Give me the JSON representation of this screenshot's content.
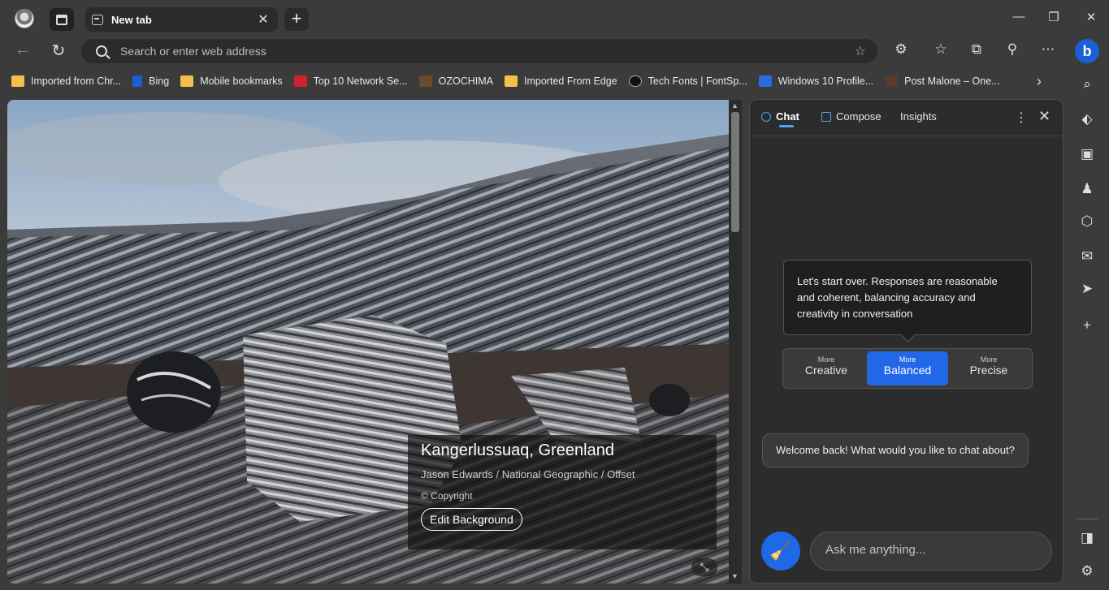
{
  "tab": {
    "title": "New tab"
  },
  "omnibox": {
    "placeholder": "Search or enter web address"
  },
  "bookmarks": [
    {
      "label": "Imported from Chr...",
      "icon": "folder-icon"
    },
    {
      "label": "Bing",
      "icon": "bing-icon"
    },
    {
      "label": "Mobile bookmarks",
      "icon": "folder-icon"
    },
    {
      "label": "Top 10 Network Se...",
      "icon": "site-icon"
    },
    {
      "label": "OZOCHIMA",
      "icon": "site-icon"
    },
    {
      "label": "Imported From Edge",
      "icon": "folder-icon"
    },
    {
      "label": "Tech Fonts | FontSp...",
      "icon": "site-icon"
    },
    {
      "label": "Windows 10 Profile...",
      "icon": "site-icon"
    },
    {
      "label": "Post Malone – One...",
      "icon": "site-icon"
    }
  ],
  "background": {
    "location": "Kangerlussuaq, Greenland",
    "credit": "Jason Edwards / National Geographic / Offset",
    "copyright": "© Copyright",
    "edit_label": "Edit Background"
  },
  "chat": {
    "tabs": {
      "chat": "Chat",
      "compose": "Compose",
      "insights": "Insights"
    },
    "tooltip": "Let's start over. Responses are reasonable and coherent, balancing accuracy and creativity in conversation",
    "modes": [
      {
        "small": "More",
        "label": "Creative"
      },
      {
        "small": "More",
        "label": "Balanced"
      },
      {
        "small": "More",
        "label": "Precise"
      }
    ],
    "welcome": "Welcome back! What would you like to chat about?",
    "ask_placeholder": "Ask me anything..."
  },
  "colors": {
    "accent": "#2267e8",
    "bing_blue": "#1a5fd6",
    "folder": "#f3c14b"
  }
}
